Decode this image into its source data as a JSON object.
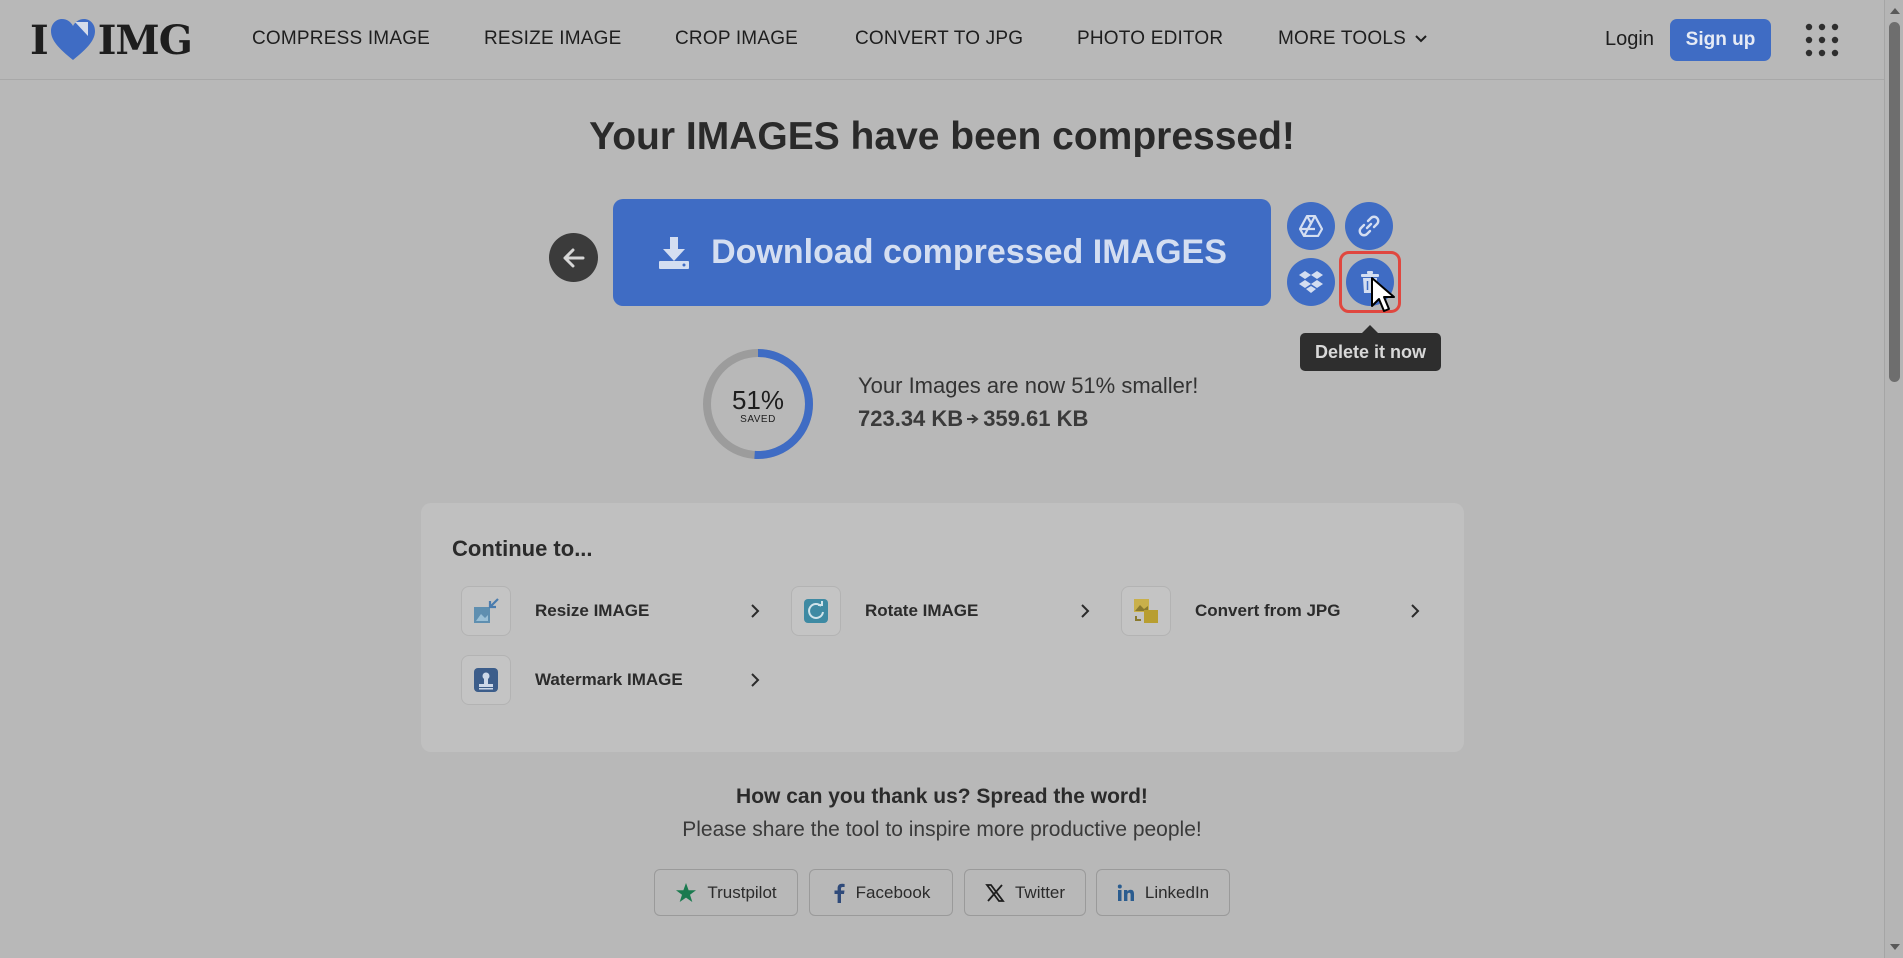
{
  "header": {
    "logo": {
      "left": "I",
      "right": "IMG"
    },
    "nav": [
      "COMPRESS IMAGE",
      "RESIZE IMAGE",
      "CROP IMAGE",
      "CONVERT TO JPG",
      "PHOTO EDITOR"
    ],
    "more_tools": "MORE TOOLS",
    "login": "Login",
    "signup": "Sign up"
  },
  "main": {
    "title": "Your IMAGES have been compressed!",
    "download_label": "Download compressed IMAGES",
    "tooltip": "Delete it now",
    "saved_percent": "51%",
    "saved_label": "SAVED",
    "saved_fraction": 0.51,
    "stats_line": "Your Images are now 51% smaller!",
    "size_before": "723.34 KB",
    "size_after": "359.61 KB"
  },
  "continue": {
    "title": "Continue to...",
    "tools": [
      {
        "label": "Resize IMAGE",
        "icon": "resize-icon"
      },
      {
        "label": "Rotate IMAGE",
        "icon": "rotate-icon"
      },
      {
        "label": "Convert from JPG",
        "icon": "convert-from-jpg-icon"
      },
      {
        "label": "Watermark IMAGE",
        "icon": "watermark-icon"
      }
    ]
  },
  "share": {
    "title": "How can you thank us? Spread the word!",
    "subtitle": "Please share the tool to inspire more productive people!",
    "buttons": [
      "Trustpilot",
      "Facebook",
      "Twitter",
      "LinkedIn"
    ]
  },
  "colors": {
    "accent": "#3f6cc4",
    "tooltip_bg": "#2e2e2e",
    "highlight": "#e0473f",
    "overlay_bg": "#b8b8b8"
  }
}
